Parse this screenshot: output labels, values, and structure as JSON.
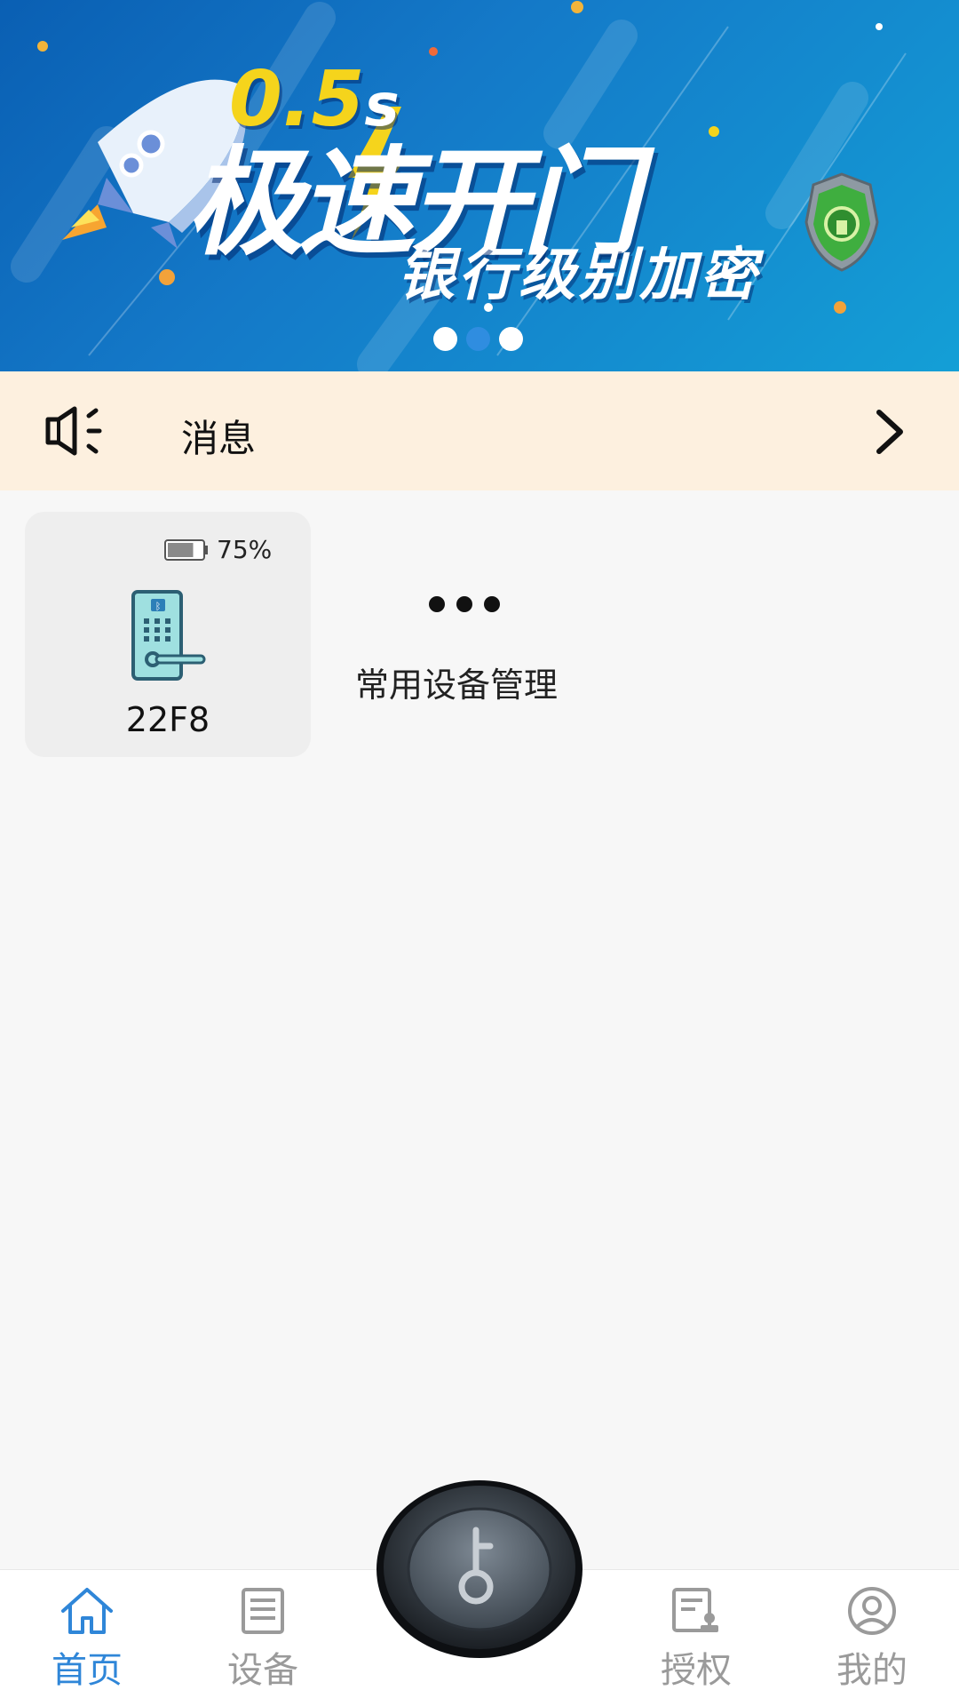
{
  "banner": {
    "speed": "0.5",
    "speed_unit": "s",
    "title": "极速开门",
    "subtitle": "银行级别加密",
    "dots_count": 3,
    "active_dot": 1,
    "icons": [
      "rocket-icon",
      "lightning-icon",
      "shield-lock-icon"
    ]
  },
  "message_bar": {
    "label": "消息",
    "icons": [
      "speaker-icon",
      "chevron-right-icon"
    ]
  },
  "device": {
    "name": "22F8",
    "battery": "75%",
    "battery_level": 0.75,
    "icon": "smart-lock-icon"
  },
  "manage": {
    "label": "常用设备管理",
    "icon": "more-dots-icon"
  },
  "tabbar": {
    "active": 0,
    "accent_color": "#2f86d8",
    "inactive_color": "#9a9a9a",
    "items": [
      {
        "label": "首页",
        "icon": "home-icon"
      },
      {
        "label": "设备",
        "icon": "device-list-icon"
      },
      {
        "label": "授权",
        "icon": "authorize-icon"
      },
      {
        "label": "我的",
        "icon": "profile-icon"
      }
    ],
    "center_button_icon": "key-icon"
  }
}
